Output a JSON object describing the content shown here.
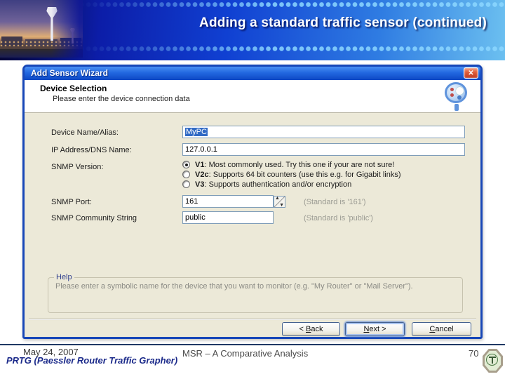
{
  "slide": {
    "title": "Adding a standard traffic sensor (continued)",
    "footer": {
      "date": "May 24, 2007",
      "left_sub": "PRTG (Paessler Router Traffic Grapher)",
      "center": "MSR – A Comparative Analysis",
      "page_number": "70"
    }
  },
  "icons": {
    "close": "✕",
    "spin_up": "▲",
    "spin_down": "▼"
  },
  "colors": {
    "banner_blue_dark": "#0c1da8",
    "banner_blue_light": "#6cc0f0",
    "dialog_border": "#1747b8",
    "titlebar_blue": "#2268e0",
    "dialog_bg": "#ECE9D8",
    "selection_blue": "#316AC5",
    "note_gray": "#9c9c94",
    "footer_navy": "#1b2a8a"
  },
  "dialog": {
    "title": "Add Sensor Wizard",
    "header": {
      "title": "Device Selection",
      "subtitle": "Please enter the device connection data"
    },
    "fields": {
      "device_name": {
        "label": "Device Name/Alias:",
        "value": "MyPC"
      },
      "ip_address": {
        "label": "IP Address/DNS Name:",
        "value": "127.0.0.1"
      },
      "snmp_version": {
        "label": "SNMP Version:",
        "options": [
          {
            "name": "V1",
            "desc": ": Most commonly used. Try this one if your are not sure!",
            "selected": true
          },
          {
            "name": "V2c",
            "desc": ": Supports 64 bit counters (use this e.g. for Gigabit links)",
            "selected": false
          },
          {
            "name": "V3",
            "desc": ": Supports authentication and/or encryption",
            "selected": false
          }
        ]
      },
      "snmp_port": {
        "label": "SNMP Port:",
        "value": "161",
        "note": "(Standard is '161')"
      },
      "snmp_community": {
        "label": "SNMP Community String",
        "value": "public",
        "note": "(Standard is 'public')"
      }
    },
    "help": {
      "label": "Help",
      "text": "Please enter a symbolic name for the device that you want to monitor (e.g. \"My Router\" or \"Mail Server\")."
    },
    "buttons": {
      "back": {
        "pre": "< ",
        "mn": "B",
        "post": "ack"
      },
      "next": {
        "pre": "",
        "mn": "N",
        "post": "ext >"
      },
      "cancel": {
        "pre": "",
        "mn": "C",
        "post": "ancel"
      }
    }
  }
}
